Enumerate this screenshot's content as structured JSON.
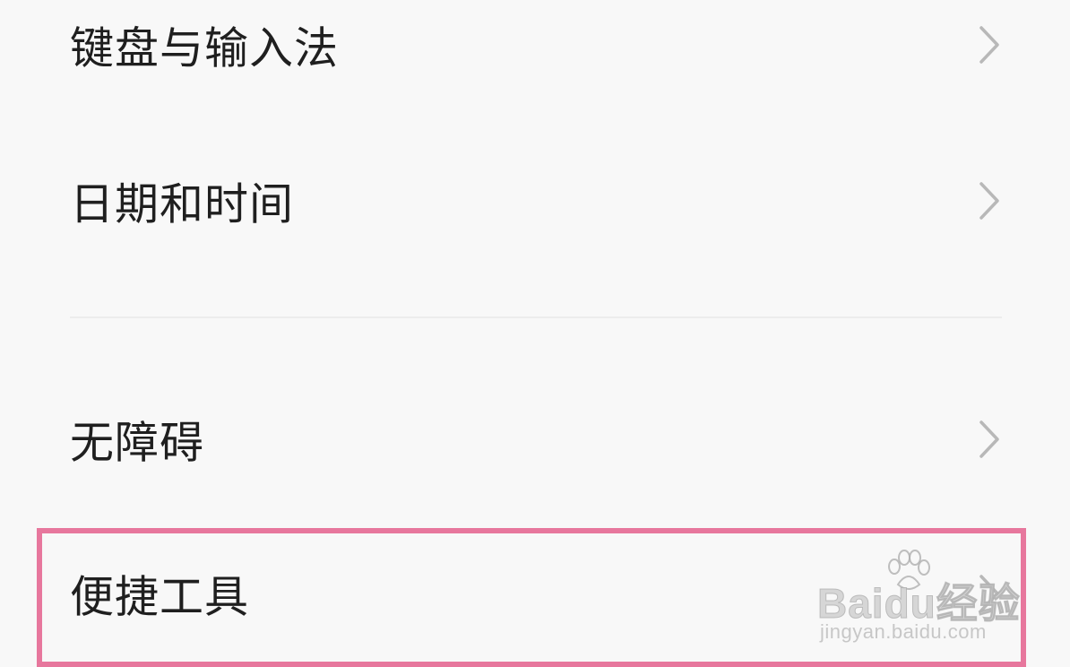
{
  "settings_list": {
    "items": [
      {
        "label": "键盘与输入法",
        "chevron": "chevron-right-icon"
      },
      {
        "label": "日期和时间",
        "chevron": "chevron-right-icon"
      },
      {
        "label": "无障碍",
        "chevron": "chevron-right-icon"
      },
      {
        "label": "便捷工具",
        "chevron": "chevron-right-icon",
        "highlighted": true
      }
    ]
  },
  "highlight": {
    "color": "#e7779d"
  },
  "watermark": {
    "brand": "Baidu经验",
    "domain": "jingyan.baidu.com"
  },
  "colors": {
    "background": "#f8f8f8",
    "text": "#1f1f1f",
    "chevron": "#b8b8b8",
    "divider": "#ececec"
  }
}
